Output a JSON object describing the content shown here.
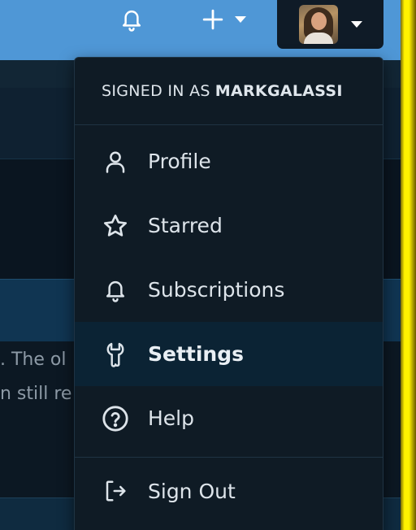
{
  "navbar": {
    "notifications_icon": "bell-icon",
    "create_icon": "plus-icon",
    "create_caret_icon": "chevron-down-icon",
    "user_menu_caret_icon": "chevron-down-icon"
  },
  "background": {
    "text_line_1": ". The ol",
    "text_line_2": "n still re"
  },
  "dropdown": {
    "signed_in_prefix": "SIGNED IN AS",
    "username": "MARKGALASSI",
    "items": [
      {
        "label": "Profile",
        "icon": "user-icon"
      },
      {
        "label": "Starred",
        "icon": "star-icon"
      },
      {
        "label": "Subscriptions",
        "icon": "bell-icon"
      },
      {
        "label": "Settings",
        "icon": "wrench-icon",
        "active": true
      },
      {
        "label": "Help",
        "icon": "help-circle-icon"
      }
    ],
    "signout": {
      "label": "Sign Out",
      "icon": "sign-out-icon"
    }
  },
  "colors": {
    "navbar": "#4f97d6",
    "menu_bg": "#0f1b25",
    "active_item_bg": "#0b2334",
    "text": "#dde4ea"
  }
}
